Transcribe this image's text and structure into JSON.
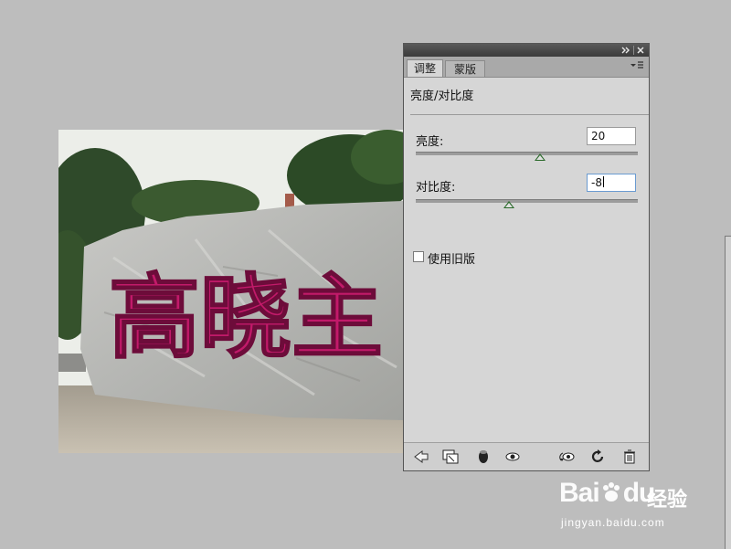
{
  "panel": {
    "collapse_icon": "double-chevron-right-icon",
    "close_icon": "close-icon",
    "menu_icon": "panel-menu-icon",
    "tabs": [
      {
        "label": "调整",
        "active": true
      },
      {
        "label": "蒙版",
        "active": false
      }
    ],
    "adjustment_title": "亮度/对比度",
    "sliders": [
      {
        "label": "亮度:",
        "value": "20",
        "level": 0.56
      },
      {
        "label": "对比度:",
        "value": "-8",
        "level": 0.42
      }
    ],
    "legacy_label": "使用旧版",
    "legacy_checked": false,
    "toolbar_icons": [
      "back-arrow-icon",
      "clip-to-layer-icon",
      "visibility-toggle-icon",
      "view-previous-state-icon",
      "reset-icon",
      "refresh-icon",
      "trash-icon"
    ]
  },
  "canvas": {
    "carved_text": "高晓主"
  },
  "watermark": {
    "brand": "Bai",
    "brand_suffix": "du",
    "cn": "经验",
    "url": "jingyan.baidu.com"
  },
  "colors": {
    "accent_thumb": "#2a6a2a",
    "carving": "#c21a6a"
  }
}
